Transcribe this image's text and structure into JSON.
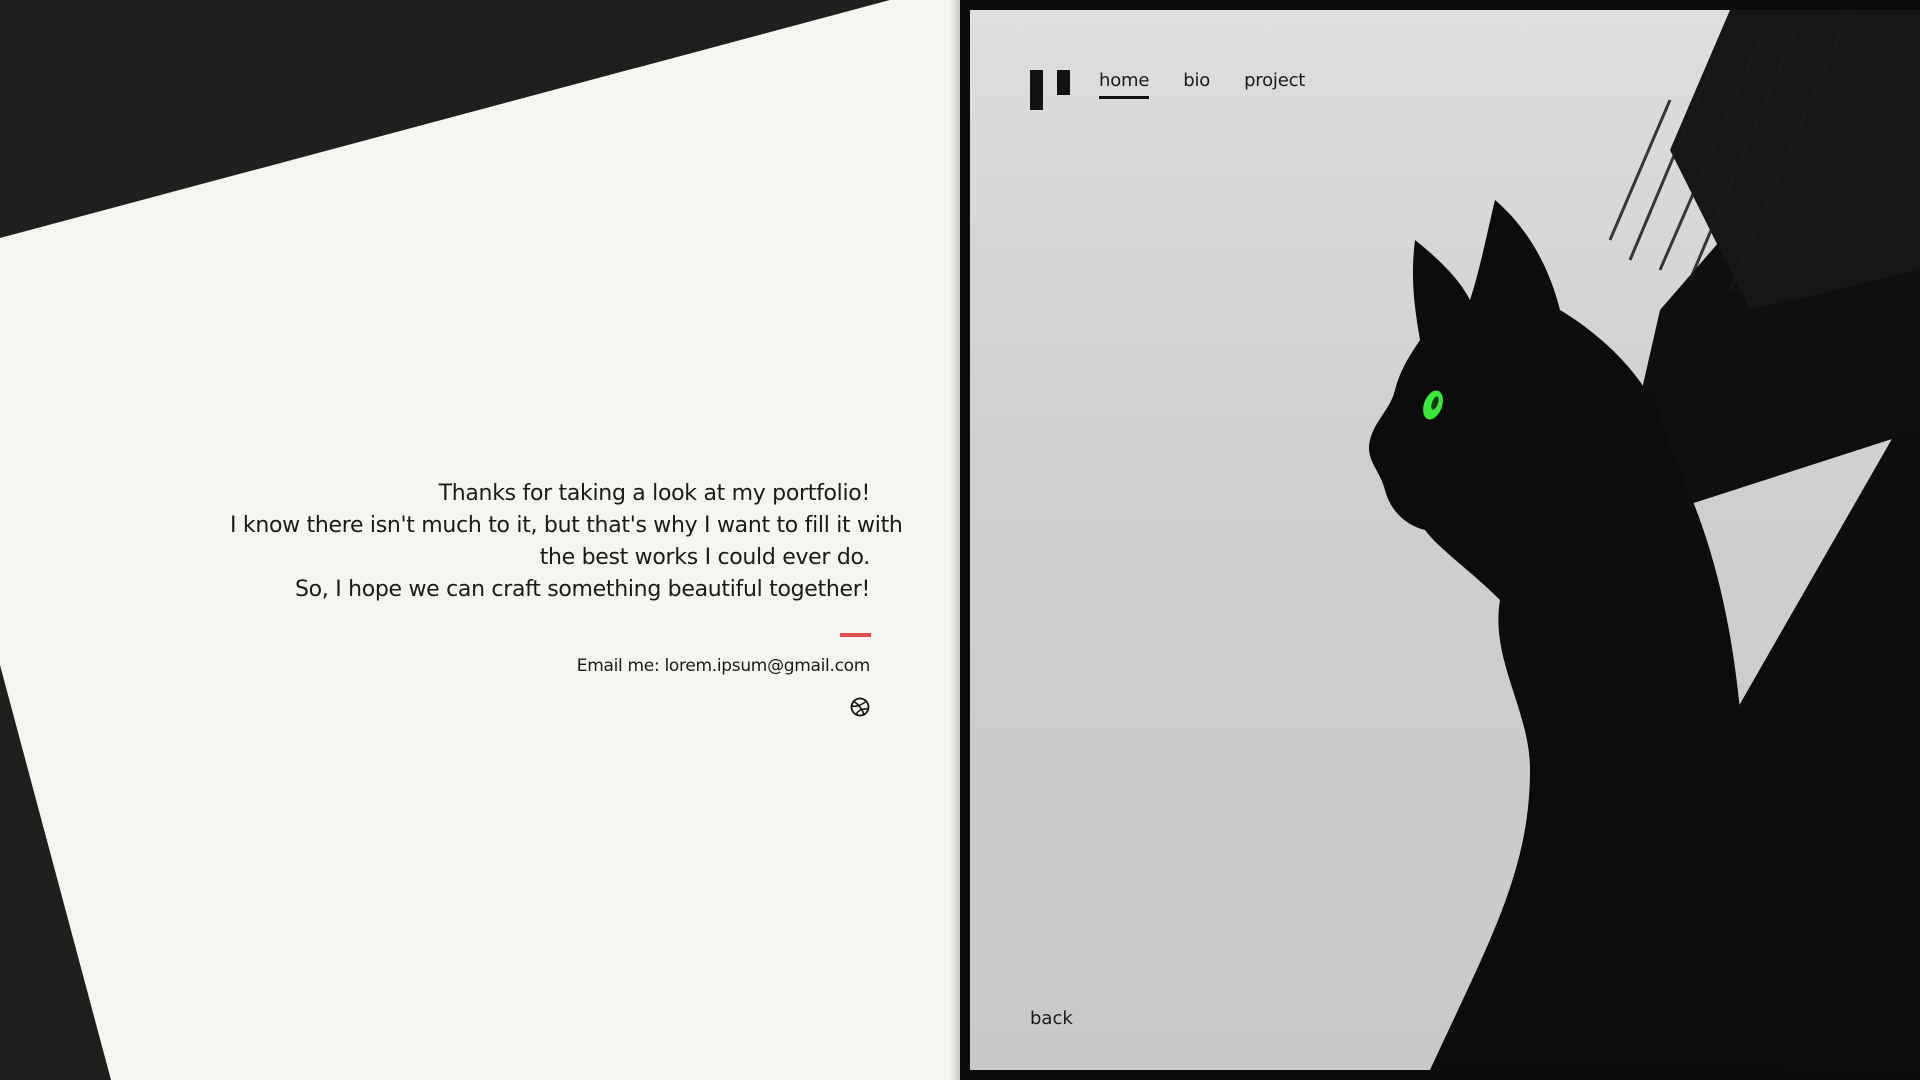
{
  "nav": {
    "items": [
      {
        "label": "home",
        "active": true
      },
      {
        "label": "bio",
        "active": false
      },
      {
        "label": "project",
        "active": false
      }
    ]
  },
  "intro": {
    "lines": [
      "Thanks for taking a look at my portfolio!",
      "I know there isn't much to it, but that's why I want to fill it with",
      "the best works I could ever do.",
      "So, I hope we can craft something beautiful together!"
    ]
  },
  "contact": {
    "email_text": "Email me: lorem.ipsum@gmail.com",
    "social_icon": "dribbble-icon"
  },
  "footer": {
    "back_label": "back"
  },
  "colors": {
    "accent": "#e0504f",
    "paper": "#f6f5f0",
    "dark": "#1f1f1f",
    "cat_eye": "#39e83a"
  }
}
